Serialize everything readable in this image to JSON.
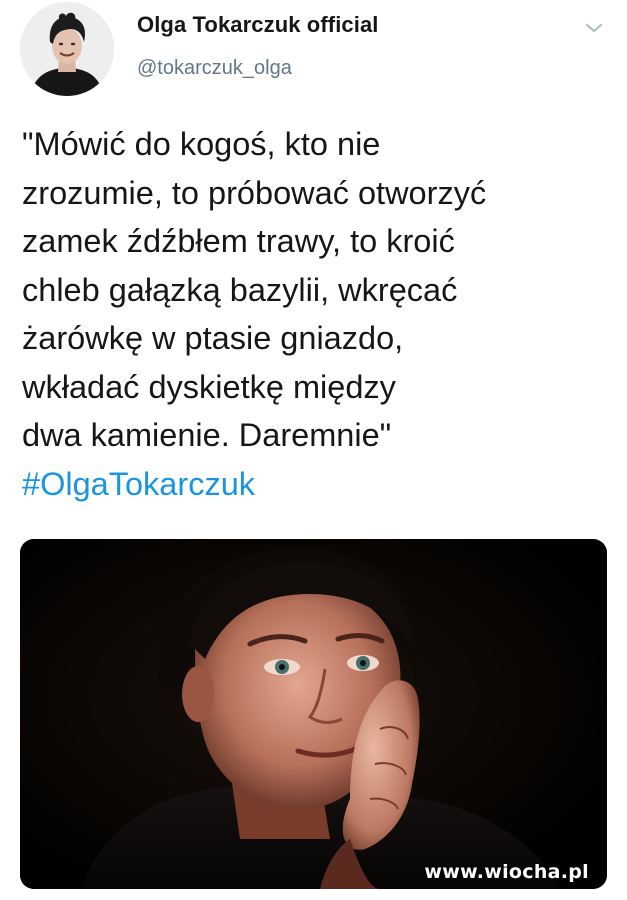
{
  "tweet": {
    "author": {
      "display_name": "Olga Tokarczuk official",
      "handle": "@tokarczuk_olga",
      "avatar_icon": "user-avatar-photo"
    },
    "menu_icon": "chevron-down-icon",
    "text_lines": [
      "\"Mówić do kogoś, kto nie",
      "zrozumie, to próbować otworzyć",
      "zamek źdźbłem trawy, to kroić",
      "chleb gałązką bazylii, wkręcać",
      "żarówkę w ptasie gniazdo,",
      "wkładać dyskietkę między",
      "dwa kamienie. Daremnie\""
    ],
    "hashtag": "#OlgaTokarczuk",
    "media": {
      "kind": "photo",
      "watermark": "www.wiocha.pl"
    }
  },
  "colors": {
    "text": "#14171a",
    "secondary": "#657786",
    "link": "#1b95e0",
    "background": "#ffffff"
  }
}
